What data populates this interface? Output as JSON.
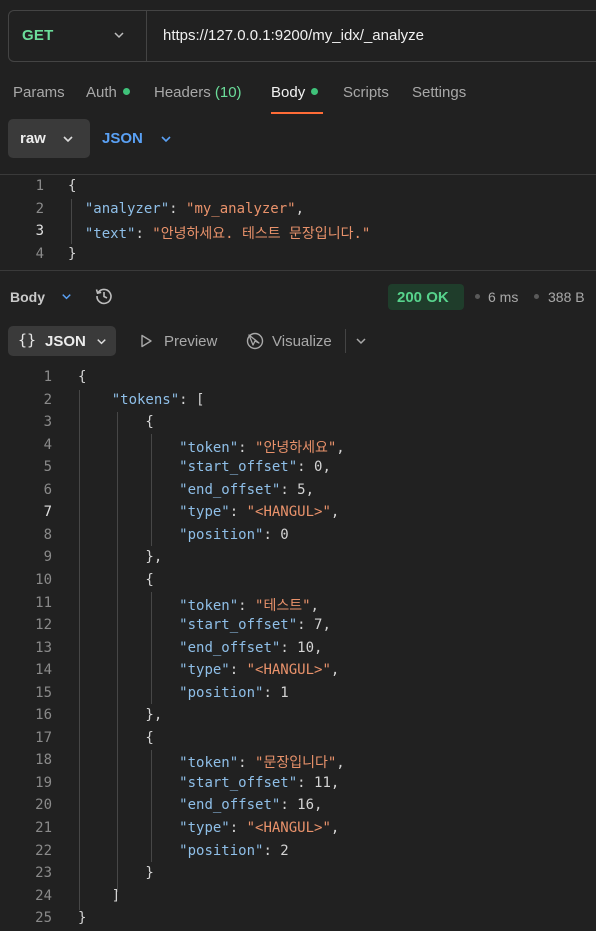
{
  "request": {
    "method": "GET",
    "url": "https://127.0.0.1:9200/my_idx/_analyze"
  },
  "tabs": {
    "params": "Params",
    "auth": "Auth",
    "headers": "Headers",
    "headers_count": "(10)",
    "body": "Body",
    "scripts": "Scripts",
    "settings": "Settings"
  },
  "body_mode": {
    "raw": "raw",
    "format": "JSON"
  },
  "request_code": [
    {
      "n": "1",
      "parts": [
        {
          "t": "{",
          "c": "n"
        }
      ]
    },
    {
      "n": "2",
      "parts": [
        {
          "t": "  ",
          "c": "n"
        },
        {
          "t": "\"analyzer\"",
          "c": "k"
        },
        {
          "t": ": ",
          "c": "n"
        },
        {
          "t": "\"my_analyzer\"",
          "c": "s"
        },
        {
          "t": ",",
          "c": "n"
        }
      ]
    },
    {
      "n": "3",
      "parts": [
        {
          "t": "  ",
          "c": "n"
        },
        {
          "t": "\"text\"",
          "c": "k"
        },
        {
          "t": ": ",
          "c": "n"
        },
        {
          "t": "\"안녕하세요. 테스트 문장입니다.\"",
          "c": "s"
        }
      ]
    },
    {
      "n": "4",
      "parts": [
        {
          "t": "}",
          "c": "n"
        }
      ]
    }
  ],
  "response": {
    "body_label": "Body",
    "status": "200 OK",
    "time": "6 ms",
    "size": "388 B",
    "format": "JSON",
    "preview": "Preview",
    "visualize": "Visualize"
  },
  "response_code": [
    {
      "n": "1",
      "parts": [
        {
          "t": "{",
          "c": "n"
        }
      ]
    },
    {
      "n": "2",
      "parts": [
        {
          "t": "    ",
          "c": "n"
        },
        {
          "t": "\"tokens\"",
          "c": "k"
        },
        {
          "t": ": [",
          "c": "n"
        }
      ]
    },
    {
      "n": "3",
      "parts": [
        {
          "t": "        {",
          "c": "n"
        }
      ]
    },
    {
      "n": "4",
      "parts": [
        {
          "t": "            ",
          "c": "n"
        },
        {
          "t": "\"token\"",
          "c": "k"
        },
        {
          "t": ": ",
          "c": "n"
        },
        {
          "t": "\"안녕하세요\"",
          "c": "s"
        },
        {
          "t": ",",
          "c": "n"
        }
      ]
    },
    {
      "n": "5",
      "parts": [
        {
          "t": "            ",
          "c": "n"
        },
        {
          "t": "\"start_offset\"",
          "c": "k"
        },
        {
          "t": ": 0,",
          "c": "n"
        }
      ]
    },
    {
      "n": "6",
      "parts": [
        {
          "t": "            ",
          "c": "n"
        },
        {
          "t": "\"end_offset\"",
          "c": "k"
        },
        {
          "t": ": 5,",
          "c": "n"
        }
      ]
    },
    {
      "n": "7",
      "parts": [
        {
          "t": "            ",
          "c": "n"
        },
        {
          "t": "\"type\"",
          "c": "k"
        },
        {
          "t": ": ",
          "c": "n"
        },
        {
          "t": "\"<HANGUL>\"",
          "c": "s"
        },
        {
          "t": ",",
          "c": "n"
        }
      ]
    },
    {
      "n": "8",
      "parts": [
        {
          "t": "            ",
          "c": "n"
        },
        {
          "t": "\"position\"",
          "c": "k"
        },
        {
          "t": ": 0",
          "c": "n"
        }
      ]
    },
    {
      "n": "9",
      "parts": [
        {
          "t": "        },",
          "c": "n"
        }
      ]
    },
    {
      "n": "10",
      "parts": [
        {
          "t": "        {",
          "c": "n"
        }
      ]
    },
    {
      "n": "11",
      "parts": [
        {
          "t": "            ",
          "c": "n"
        },
        {
          "t": "\"token\"",
          "c": "k"
        },
        {
          "t": ": ",
          "c": "n"
        },
        {
          "t": "\"테스트\"",
          "c": "s"
        },
        {
          "t": ",",
          "c": "n"
        }
      ]
    },
    {
      "n": "12",
      "parts": [
        {
          "t": "            ",
          "c": "n"
        },
        {
          "t": "\"start_offset\"",
          "c": "k"
        },
        {
          "t": ": 7,",
          "c": "n"
        }
      ]
    },
    {
      "n": "13",
      "parts": [
        {
          "t": "            ",
          "c": "n"
        },
        {
          "t": "\"end_offset\"",
          "c": "k"
        },
        {
          "t": ": 10,",
          "c": "n"
        }
      ]
    },
    {
      "n": "14",
      "parts": [
        {
          "t": "            ",
          "c": "n"
        },
        {
          "t": "\"type\"",
          "c": "k"
        },
        {
          "t": ": ",
          "c": "n"
        },
        {
          "t": "\"<HANGUL>\"",
          "c": "s"
        },
        {
          "t": ",",
          "c": "n"
        }
      ]
    },
    {
      "n": "15",
      "parts": [
        {
          "t": "            ",
          "c": "n"
        },
        {
          "t": "\"position\"",
          "c": "k"
        },
        {
          "t": ": 1",
          "c": "n"
        }
      ]
    },
    {
      "n": "16",
      "parts": [
        {
          "t": "        },",
          "c": "n"
        }
      ]
    },
    {
      "n": "17",
      "parts": [
        {
          "t": "        {",
          "c": "n"
        }
      ]
    },
    {
      "n": "18",
      "parts": [
        {
          "t": "            ",
          "c": "n"
        },
        {
          "t": "\"token\"",
          "c": "k"
        },
        {
          "t": ": ",
          "c": "n"
        },
        {
          "t": "\"문장입니다\"",
          "c": "s"
        },
        {
          "t": ",",
          "c": "n"
        }
      ]
    },
    {
      "n": "19",
      "parts": [
        {
          "t": "            ",
          "c": "n"
        },
        {
          "t": "\"start_offset\"",
          "c": "k"
        },
        {
          "t": ": 11,",
          "c": "n"
        }
      ]
    },
    {
      "n": "20",
      "parts": [
        {
          "t": "            ",
          "c": "n"
        },
        {
          "t": "\"end_offset\"",
          "c": "k"
        },
        {
          "t": ": 16,",
          "c": "n"
        }
      ]
    },
    {
      "n": "21",
      "parts": [
        {
          "t": "            ",
          "c": "n"
        },
        {
          "t": "\"type\"",
          "c": "k"
        },
        {
          "t": ": ",
          "c": "n"
        },
        {
          "t": "\"<HANGUL>\"",
          "c": "s"
        },
        {
          "t": ",",
          "c": "n"
        }
      ]
    },
    {
      "n": "22",
      "parts": [
        {
          "t": "            ",
          "c": "n"
        },
        {
          "t": "\"position\"",
          "c": "k"
        },
        {
          "t": ": 2",
          "c": "n"
        }
      ]
    },
    {
      "n": "23",
      "parts": [
        {
          "t": "        }",
          "c": "n"
        }
      ]
    },
    {
      "n": "24",
      "parts": [
        {
          "t": "    ]",
          "c": "n"
        }
      ]
    },
    {
      "n": "25",
      "parts": [
        {
          "t": "}",
          "c": "n"
        }
      ]
    }
  ],
  "colors": {
    "method": "#6bdd9a",
    "accent": "#ff6c37",
    "status_ok": "#57d38c",
    "json_key": "#8fbfe8",
    "json_string": "#e9926b"
  },
  "icons": [
    "chevron-down-icon",
    "history-icon",
    "play-icon",
    "visualize-icon"
  ]
}
